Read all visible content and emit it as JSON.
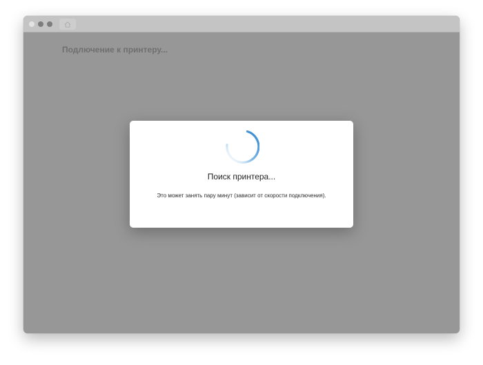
{
  "page": {
    "title": "Подлючение к принтеру..."
  },
  "window": {
    "controls": [
      "close",
      "minimize",
      "maximize"
    ],
    "tab_icon": "home-icon"
  },
  "dialog": {
    "title": "Поиск принтера...",
    "message": "Это может занять пару минут (зависит от скорости подключения).",
    "spinner_icon": "loading-spinner-icon",
    "accent_color": "#3b8fd4"
  },
  "colors": {
    "background_overlay": "#979797",
    "titlebar": "#c4c4c4",
    "dialog_background": "#ffffff"
  }
}
